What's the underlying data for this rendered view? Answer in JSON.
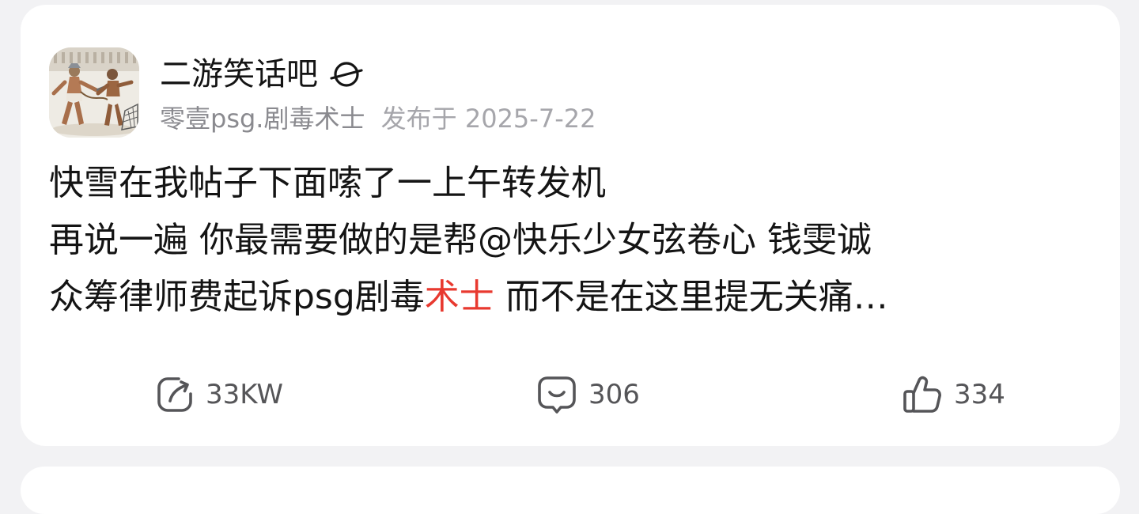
{
  "post": {
    "forum_name": "二游笑话吧",
    "forum_badge_icon": "planet-icon",
    "author": "零壹psg.剧毒术士",
    "posted_prefix": "发布于",
    "posted_date": "2025-7-22",
    "content": {
      "line1": "快雪在我帖子下面嗦了一上午转发机",
      "line2": "再说一遍 你最需要做的是帮@快乐少女弦卷心 钱雯诚",
      "line3_part1": "众筹律师费起诉psg剧毒",
      "line3_highlight": "术士",
      "line3_part2": " 而不是在这里提无关痛…"
    },
    "highlight_color": "#e8392f"
  },
  "actions": {
    "share": {
      "icon": "share-icon",
      "count": "33KW"
    },
    "comment": {
      "icon": "comment-icon",
      "count": "306"
    },
    "like": {
      "icon": "thumbs-up-icon",
      "count": "334"
    }
  }
}
